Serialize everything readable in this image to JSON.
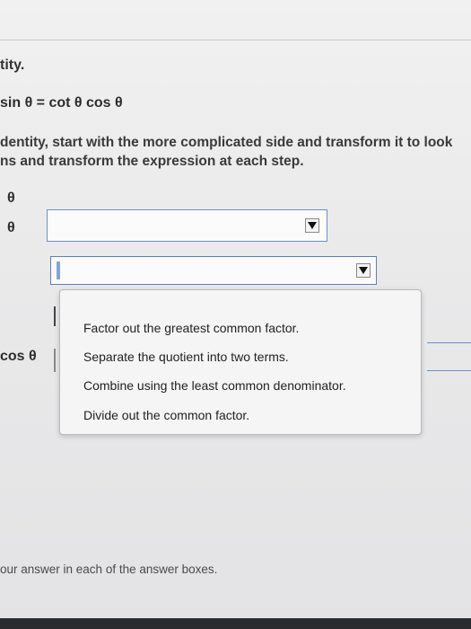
{
  "instruction_fragment": "tity.",
  "identity": "sin θ = cot θ cos θ",
  "paragraph": {
    "line1": "dentity, start with the more complicated side and transform it to look",
    "line2": "ns and transform the expression at each step."
  },
  "rows": {
    "row1_label": "θ",
    "row2_label": "θ",
    "row3_label": "cos θ"
  },
  "dropdown": {
    "options": [
      "Factor out the greatest common factor.",
      "Separate the quotient into two terms.",
      "Combine using the least common denominator.",
      "Divide out the common factor."
    ]
  },
  "footer": "our answer in each of the answer boxes.",
  "colors": {
    "select_border": "#6b8fc4",
    "background": "#ececed"
  }
}
